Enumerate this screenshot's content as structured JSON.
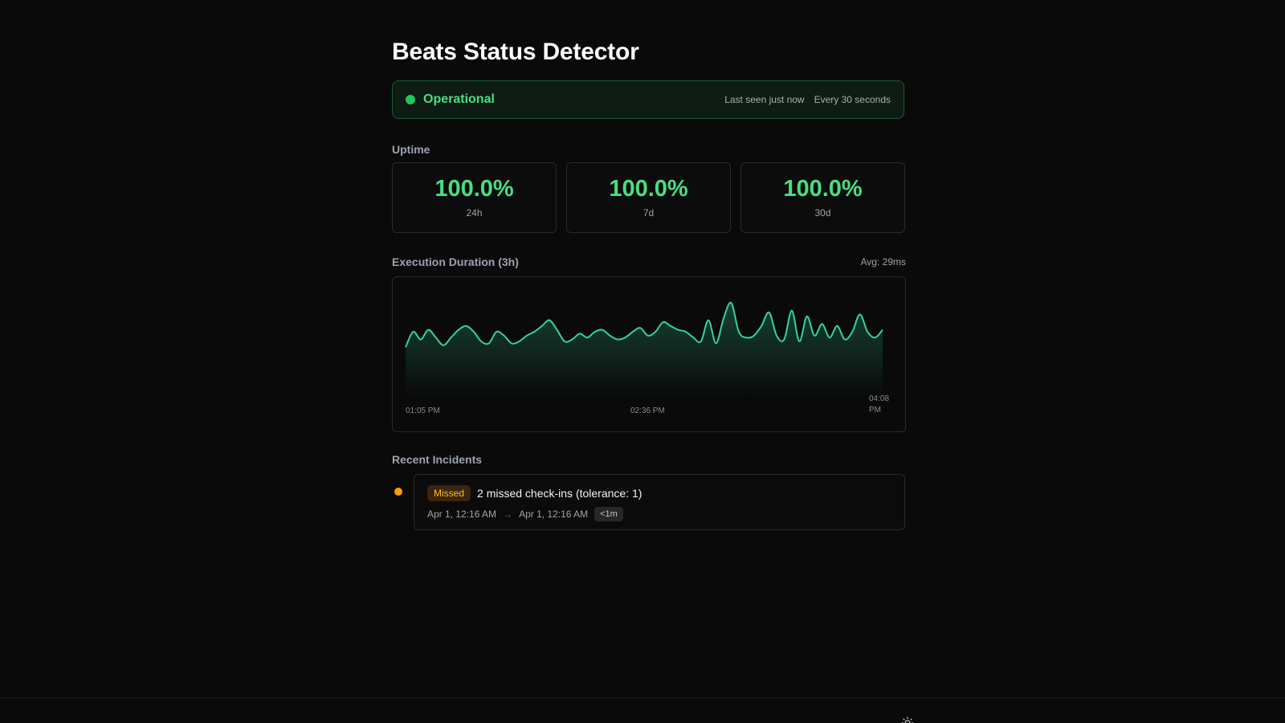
{
  "page": {
    "title": "Beats Status Detector"
  },
  "status": {
    "label": "Operational",
    "last_seen": "Last seen just now",
    "interval": "Every 30 seconds",
    "color": "#22c55e"
  },
  "uptime": {
    "label": "Uptime",
    "cards": [
      {
        "value": "100.0%",
        "period": "24h"
      },
      {
        "value": "100.0%",
        "period": "7d"
      },
      {
        "value": "100.0%",
        "period": "30d"
      }
    ]
  },
  "execution": {
    "label": "Execution Duration (3h)",
    "avg": "Avg: 29ms"
  },
  "chart_data": {
    "type": "area",
    "title": "Execution Duration (3h)",
    "xlabel": "",
    "ylabel": "",
    "x_tick_labels": [
      "01:05 PM",
      "02:36 PM",
      "04:08 PM"
    ],
    "grid": false,
    "legend": "none",
    "color": "#34d399",
    "series": [
      {
        "values": [
          22,
          30,
          26,
          31,
          27,
          23,
          27,
          31,
          33,
          30,
          25,
          24,
          30,
          28,
          24,
          25,
          28,
          30,
          33,
          36,
          31,
          25,
          26,
          29,
          27,
          30,
          31,
          28,
          26,
          27,
          30,
          32,
          28,
          30,
          35,
          33,
          31,
          30,
          27,
          25,
          36,
          24,
          37,
          45,
          30,
          27,
          28,
          33,
          40,
          28,
          26,
          41,
          25,
          38,
          28,
          34,
          27,
          33,
          26,
          30,
          39,
          30,
          27,
          31
        ]
      }
    ]
  },
  "incidents": {
    "label": "Recent Incidents",
    "items": [
      {
        "badge": "Missed",
        "title": "2 missed check-ins (tolerance: 1)",
        "start": "Apr 1, 12:16 AM",
        "arrow": "→",
        "end": "Apr 1, 12:16 AM",
        "duration": "<1m",
        "color": "#f59e0b"
      }
    ]
  },
  "footer": {
    "theme_icon": "sun-icon"
  }
}
